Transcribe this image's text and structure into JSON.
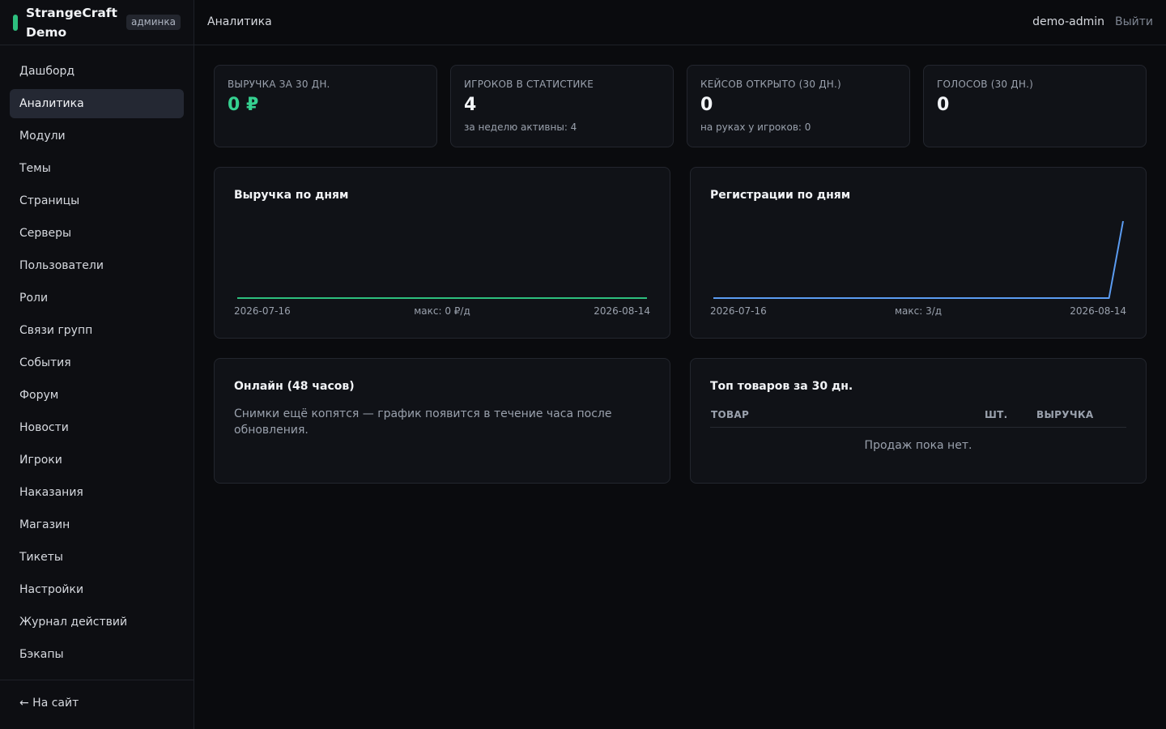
{
  "brand": {
    "name": "StrangeCraft Demo",
    "badge": "админка",
    "accent": "#2dbf7e"
  },
  "sidebar": {
    "items": [
      {
        "label": "Дашборд"
      },
      {
        "label": "Аналитика",
        "active": true
      },
      {
        "label": "Модули"
      },
      {
        "label": "Темы"
      },
      {
        "label": "Страницы"
      },
      {
        "label": "Серверы"
      },
      {
        "label": "Пользователи"
      },
      {
        "label": "Роли"
      },
      {
        "label": "Связи групп"
      },
      {
        "label": "События"
      },
      {
        "label": "Форум"
      },
      {
        "label": "Новости"
      },
      {
        "label": "Игроки"
      },
      {
        "label": "Наказания"
      },
      {
        "label": "Магазин"
      },
      {
        "label": "Тикеты"
      },
      {
        "label": "Настройки"
      },
      {
        "label": "Журнал действий"
      },
      {
        "label": "Бэкапы"
      }
    ],
    "back_label": "← На сайт"
  },
  "topbar": {
    "title": "Аналитика",
    "user": "demo-admin",
    "logout": "Выйти"
  },
  "stats": [
    {
      "label": "ВЫРУЧКА ЗА 30 ДН.",
      "value": "0 ₽",
      "sub": ""
    },
    {
      "label": "ИГРОКОВ В СТАТИСТИКЕ",
      "value": "4",
      "sub": "за неделю активны: 4"
    },
    {
      "label": "КЕЙСОВ ОТКРЫТО (30 ДН.)",
      "value": "0",
      "sub": "на руках у игроков: 0"
    },
    {
      "label": "ГОЛОСОВ (30 ДН.)",
      "value": "0",
      "sub": ""
    }
  ],
  "chart_data": [
    {
      "type": "line",
      "title": "Выручка по дням",
      "x_start": "2026-07-16",
      "x_end": "2026-08-14",
      "max_label": "макс: 0 ₽/д",
      "color": "#2dbf7e",
      "values": [
        0,
        0,
        0,
        0,
        0,
        0,
        0,
        0,
        0,
        0,
        0,
        0,
        0,
        0,
        0,
        0,
        0,
        0,
        0,
        0,
        0,
        0,
        0,
        0,
        0,
        0,
        0,
        0,
        0,
        0
      ],
      "ylim": [
        0,
        1
      ]
    },
    {
      "type": "line",
      "title": "Регистрации по дням",
      "x_start": "2026-07-16",
      "x_end": "2026-08-14",
      "max_label": "макс: 3/д",
      "color": "#5b9cf2",
      "values": [
        0,
        0,
        0,
        0,
        0,
        0,
        0,
        0,
        0,
        0,
        0,
        0,
        0,
        0,
        0,
        0,
        0,
        0,
        0,
        0,
        0,
        0,
        0,
        0,
        0,
        0,
        0,
        0,
        0,
        3
      ],
      "ylim": [
        0,
        3
      ]
    }
  ],
  "online": {
    "title": "Онлайн (48 часов)",
    "message": "Снимки ещё копятся — график появится в течение часа после обновления."
  },
  "top_products": {
    "title": "Топ товаров за 30 дн.",
    "columns": [
      "ТОВАР",
      "ШТ.",
      "ВЫРУЧКА"
    ],
    "empty": "Продаж пока нет."
  }
}
